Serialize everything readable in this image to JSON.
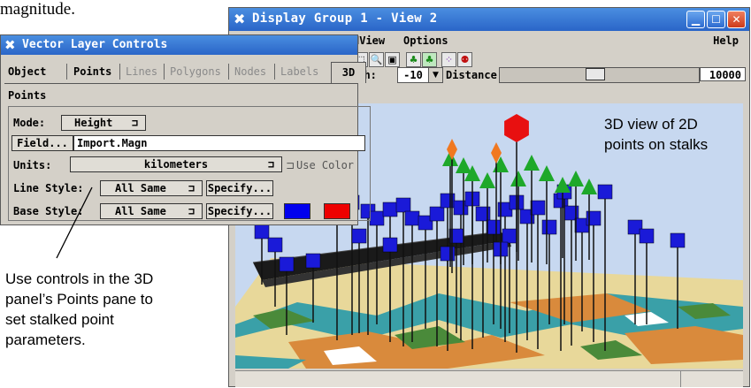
{
  "captions": {
    "top": "magnitude.",
    "left_lines": [
      "Use controls in the 3D",
      "panel’s Points pane to",
      "set stalked point",
      "parameters."
    ]
  },
  "display_window": {
    "icon": "tntmips-x-icon",
    "title": "Display Group 1 - View 2",
    "buttons": [
      "minimize",
      "maximize",
      "close"
    ],
    "menu": {
      "view": "dView",
      "options": "Options",
      "help": "Help"
    },
    "toolbar_icons": [
      "select-icon",
      "zoom-icon",
      "snapshot-icon",
      "tree-icon",
      "tree-highlight-icon",
      "scatter-icon",
      "viewer-icon"
    ],
    "pitch": {
      "label": "tch:",
      "value": "-10"
    },
    "distance": {
      "label": "Distance:",
      "value": "10000",
      "level_fraction": 0.48
    },
    "annotation_lines": [
      "3D view of 2D",
      "points on stalks"
    ]
  },
  "vector_controls": {
    "icon": "tntmips-x-icon",
    "title": "Vector Layer Controls",
    "tabs": [
      {
        "label": "Object",
        "enabled": true
      },
      {
        "label": "Points",
        "enabled": true
      },
      {
        "label": "Lines",
        "enabled": false
      },
      {
        "label": "Polygons",
        "enabled": false
      },
      {
        "label": "Nodes",
        "enabled": false
      },
      {
        "label": "Labels",
        "enabled": false
      },
      {
        "label": "3D",
        "enabled": true,
        "selected": true
      }
    ],
    "pane_title": "Points",
    "mode": {
      "label": "Mode:",
      "value": "Height"
    },
    "field": {
      "button": "Field...",
      "value": "Import.Magn"
    },
    "units": {
      "label": "Units:",
      "value": "kilometers",
      "use_color": "Use Color"
    },
    "line_style": {
      "label": "Line Style:",
      "value": "All Same",
      "specify": "Specify..."
    },
    "base_style": {
      "label": "Base Style:",
      "value": "All Same",
      "specify": "Specify...",
      "swatches": [
        "#0000ee",
        "#ee0000"
      ]
    }
  },
  "colors": {
    "title_bar": "#2a65c8",
    "stalk_marker": "#1a1ad8",
    "tree_marker": "#1ea82a",
    "orange_marker": "#f07820",
    "red_marker": "#e81010",
    "sky": "#c7d8f0"
  }
}
